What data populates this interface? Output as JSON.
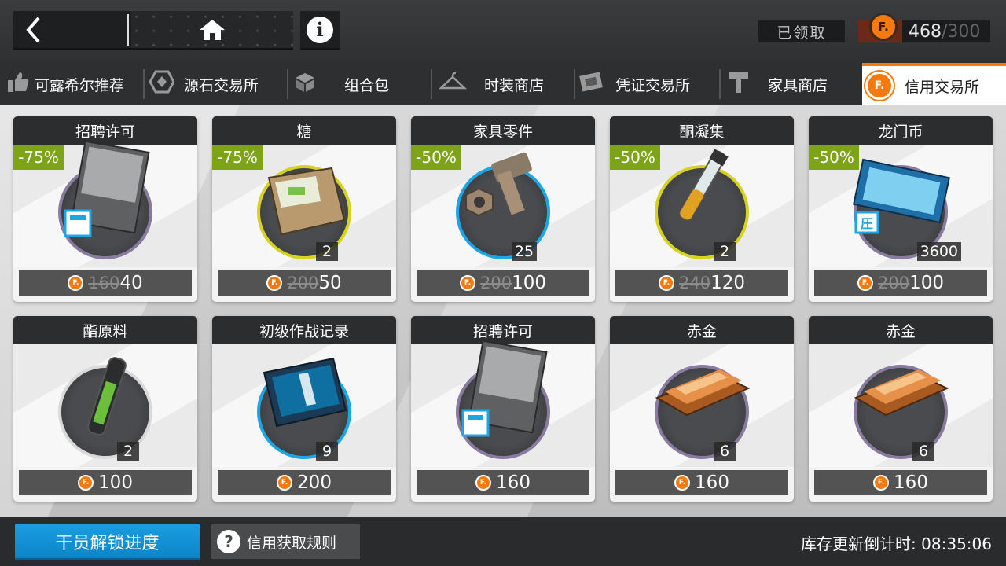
{
  "header": {
    "claimed_label": "已领取",
    "credits_current": "468",
    "credits_separator": "/",
    "credits_max": "300",
    "credit_icon_glyph": "F."
  },
  "tabs": [
    {
      "label": "可露希尔推荐",
      "icon": "thumbs-up-icon"
    },
    {
      "label": "源石交易所",
      "icon": "originite-icon"
    },
    {
      "label": "组合包",
      "icon": "bundle-icon"
    },
    {
      "label": "时装商店",
      "icon": "hanger-icon"
    },
    {
      "label": "凭证交易所",
      "icon": "voucher-icon"
    },
    {
      "label": "家具商店",
      "icon": "hammer-icon"
    },
    {
      "label": "信用交易所",
      "icon": "credit-icon",
      "active": true
    }
  ],
  "items": [
    {
      "name": "招聘许可",
      "discount": "-75%",
      "qty": "",
      "old_price": "160",
      "price": "40",
      "ring": "purple",
      "art": "permit"
    },
    {
      "name": "糖",
      "discount": "-75%",
      "qty": "2",
      "old_price": "200",
      "price": "50",
      "ring": "gold",
      "art": "sugar"
    },
    {
      "name": "家具零件",
      "discount": "-50%",
      "qty": "25",
      "old_price": "200",
      "price": "100",
      "ring": "blue",
      "art": "bolt"
    },
    {
      "name": "酮凝集",
      "discount": "-50%",
      "qty": "2",
      "old_price": "240",
      "price": "120",
      "ring": "gold",
      "art": "vial"
    },
    {
      "name": "龙门币",
      "discount": "-50%",
      "qty": "3600",
      "old_price": "200",
      "price": "100",
      "ring": "purple",
      "art": "lmd"
    },
    {
      "name": "酯原料",
      "discount": "",
      "qty": "2",
      "old_price": "",
      "price": "100",
      "ring": "gray",
      "art": "tube"
    },
    {
      "name": "初级作战记录",
      "discount": "",
      "qty": "9",
      "old_price": "",
      "price": "200",
      "ring": "blue",
      "art": "record"
    },
    {
      "name": "招聘许可",
      "discount": "",
      "qty": "",
      "old_price": "",
      "price": "160",
      "ring": "purple",
      "art": "permit"
    },
    {
      "name": "赤金",
      "discount": "",
      "qty": "6",
      "old_price": "",
      "price": "160",
      "ring": "purple",
      "art": "gold"
    },
    {
      "name": "赤金",
      "discount": "",
      "qty": "6",
      "old_price": "",
      "price": "160",
      "ring": "purple",
      "art": "gold"
    }
  ],
  "footer": {
    "unlock_label": "干员解锁进度",
    "rules_label": "信用获取规则",
    "rules_icon": "question-icon",
    "countdown_label": "库存更新倒计时:",
    "countdown_time": "08:35:06"
  },
  "colors": {
    "accent_orange": "#f47a10",
    "discount_green": "#7da419",
    "unlock_blue": "#1a9de0"
  }
}
